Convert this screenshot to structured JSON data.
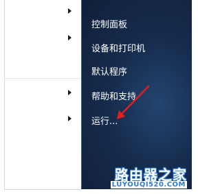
{
  "start_menu": {
    "right_items": [
      {
        "label": "控制面板"
      },
      {
        "label": "设备和打印机"
      },
      {
        "label": "默认程序"
      },
      {
        "label": "帮助和支持"
      },
      {
        "label": "运行..."
      }
    ]
  },
  "watermark": {
    "title": "路由器之家",
    "url": "LUYOUQI520.COM"
  },
  "colors": {
    "pane_dark": "#162c4d",
    "annotation_arrow": "#e02020",
    "watermark_blue": "#2b7bd1"
  }
}
